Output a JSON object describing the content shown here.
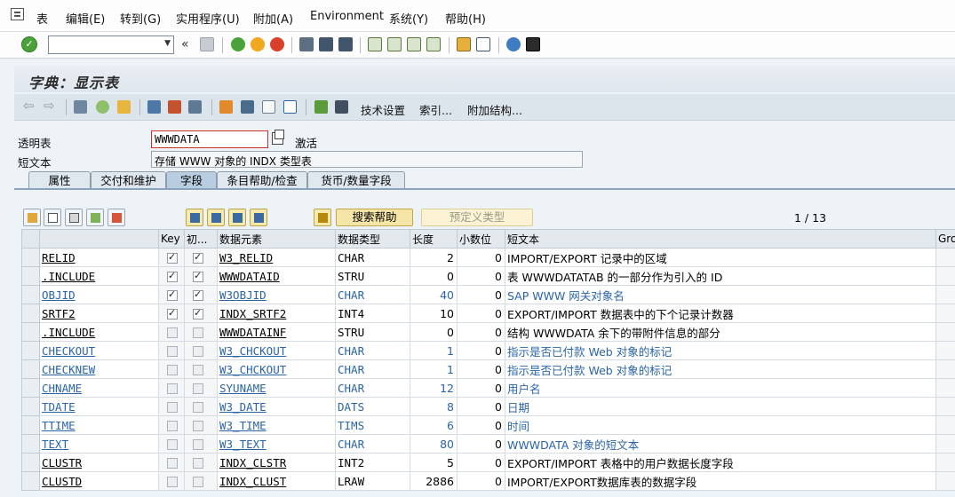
{
  "menu": {
    "items": [
      "表",
      "编辑(E)",
      "转到(G)",
      "实用程序(U)",
      "附加(A)",
      "Environment",
      "系统(Y)",
      "帮助(H)"
    ]
  },
  "toolbar": {
    "command_value": "",
    "chevron": "«"
  },
  "title": "字典：显示表",
  "appbar": {
    "tech_settings": "技术设置",
    "indexes": "索引...",
    "append_struct": "附加结构..."
  },
  "header": {
    "table_label": "透明表",
    "table_name": "WWWDATA",
    "status": "激活",
    "short_label": "短文本",
    "short_text": "存储 WWW 对象的 INDX 类型表"
  },
  "tabs": [
    "属性",
    "交付和维护",
    "字段",
    "条目帮助/检查",
    "货币/数量字段"
  ],
  "active_tab": 2,
  "grid_buttons": {
    "search_help": "搜索帮助",
    "predefined_type": "预定义类型",
    "pager": "1  /  13"
  },
  "columns": [
    "",
    "Key",
    "初...",
    "数据元素",
    "数据类型",
    "长度",
    "小数位",
    "短文本",
    "Gro"
  ],
  "rows": [
    {
      "field": "RELID",
      "key": true,
      "init": true,
      "element": "W3_RELID",
      "type": "CHAR",
      "length": "2",
      "decimals": "0",
      "text": "IMPORT/EXPORT 记录中的区域",
      "link": false
    },
    {
      "field": ".INCLUDE",
      "key": true,
      "init": true,
      "element": "WWWDATAID",
      "type": "STRU",
      "length": "0",
      "decimals": "0",
      "text": "表 WWWDATATAB 的一部分作为引入的 ID",
      "link": false
    },
    {
      "field": "OBJID",
      "key": true,
      "init": true,
      "element": "W3OBJID",
      "type": "CHAR",
      "length": "40",
      "decimals": "0",
      "text": "SAP WWW 网关对象名",
      "link": true
    },
    {
      "field": "SRTF2",
      "key": true,
      "init": true,
      "element": "INDX_SRTF2",
      "type": "INT4",
      "length": "10",
      "decimals": "0",
      "text": "EXPORT/IMPORT 数据表中的下个记录计数器",
      "link": false
    },
    {
      "field": ".INCLUDE",
      "key": false,
      "init": false,
      "element": "WWWDATAINF",
      "type": "STRU",
      "length": "0",
      "decimals": "0",
      "text": "结构 WWWDATA 余下的带附件信息的部分",
      "link": false
    },
    {
      "field": "CHECKOUT",
      "key": false,
      "init": false,
      "element": "W3_CHCKOUT",
      "type": "CHAR",
      "length": "1",
      "decimals": "0",
      "text": "指示是否已付款 Web 对象的标记",
      "link": true
    },
    {
      "field": "CHECKNEW",
      "key": false,
      "init": false,
      "element": "W3_CHCKOUT",
      "type": "CHAR",
      "length": "1",
      "decimals": "0",
      "text": "指示是否已付款 Web 对象的标记",
      "link": true
    },
    {
      "field": "CHNAME",
      "key": false,
      "init": false,
      "element": "SYUNAME",
      "type": "CHAR",
      "length": "12",
      "decimals": "0",
      "text": "用户名",
      "link": true
    },
    {
      "field": "TDATE",
      "key": false,
      "init": false,
      "element": "W3_DATE",
      "type": "DATS",
      "length": "8",
      "decimals": "0",
      "text": "日期",
      "link": true
    },
    {
      "field": "TTIME",
      "key": false,
      "init": false,
      "element": "W3_TIME",
      "type": "TIMS",
      "length": "6",
      "decimals": "0",
      "text": "时间",
      "link": true
    },
    {
      "field": "TEXT",
      "key": false,
      "init": false,
      "element": "W3_TEXT",
      "type": "CHAR",
      "length": "80",
      "decimals": "0",
      "text": "WWWDATA 对象的短文本",
      "link": true
    },
    {
      "field": "CLUSTR",
      "key": false,
      "init": false,
      "element": "INDX_CLSTR",
      "type": "INT2",
      "length": "5",
      "decimals": "0",
      "text": "EXPORT/IMPORT 表格中的用户数据长度字段",
      "link": false
    },
    {
      "field": "CLUSTD",
      "key": false,
      "init": false,
      "element": "INDX_CLUST",
      "type": "LRAW",
      "length": "2886",
      "decimals": "0",
      "text": "IMPORT/EXPORT数据库表的数据字段",
      "link": false
    }
  ],
  "colors": {
    "accent": "#2a64a8",
    "focus_border": "#c9302c",
    "tab_active": "#b8cde0"
  }
}
